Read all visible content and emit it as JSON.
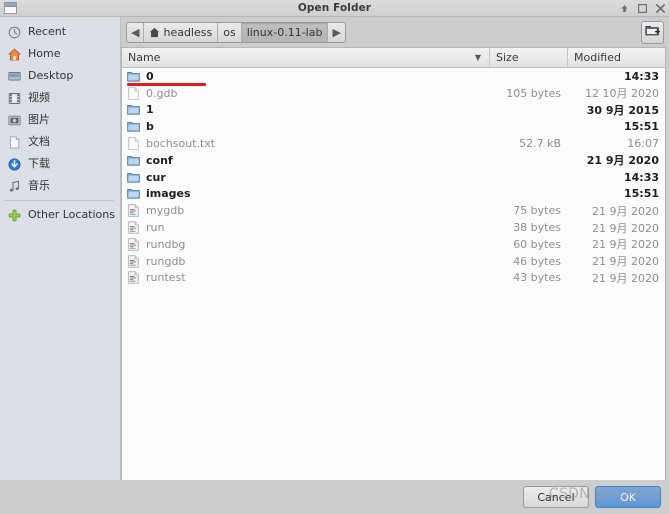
{
  "window": {
    "title": "Open Folder",
    "icon": "window-icon",
    "buttons": [
      {
        "name": "shade-button",
        "glyph": "shade-arrow-icon"
      },
      {
        "name": "maximize-button",
        "glyph": "maximize-icon"
      },
      {
        "name": "close-button",
        "glyph": "close-icon"
      }
    ]
  },
  "sidebar": {
    "items": [
      {
        "label": "Recent",
        "icon": "recent-clock-icon"
      },
      {
        "label": "Home",
        "icon": "home-icon"
      },
      {
        "label": "Desktop",
        "icon": "desktop-icon"
      },
      {
        "label": "视频",
        "icon": "videos-icon"
      },
      {
        "label": "图片",
        "icon": "pictures-icon"
      },
      {
        "label": "文档",
        "icon": "documents-icon"
      },
      {
        "label": "下载",
        "icon": "downloads-icon"
      },
      {
        "label": "音乐",
        "icon": "music-icon"
      }
    ],
    "other_locations": {
      "label": "Other Locations",
      "icon": "plus-icon"
    }
  },
  "pathbar": {
    "prev_arrow": "◀",
    "next_arrow": "▶",
    "crumbs": [
      {
        "label": "headless",
        "icon": "home-icon",
        "selected": false
      },
      {
        "label": "os",
        "icon": "",
        "selected": false
      },
      {
        "label": "linux-0.11-lab",
        "icon": "",
        "selected": true
      }
    ],
    "new_folder_button": "create-folder-icon"
  },
  "filelist": {
    "columns": {
      "name": "Name",
      "size": "Size",
      "modified": "Modified"
    },
    "sort_caret": "▼",
    "rows": [
      {
        "name": "0",
        "type": "dir",
        "size": "",
        "modified": "14:33",
        "annotated": true
      },
      {
        "name": "0.gdb",
        "type": "file",
        "size": "105 bytes",
        "modified": "12 10月 2020",
        "annotated": false
      },
      {
        "name": "1",
        "type": "dir",
        "size": "",
        "modified": "30 9月 2015",
        "annotated": false
      },
      {
        "name": "b",
        "type": "dir",
        "size": "",
        "modified": "15:51",
        "annotated": false
      },
      {
        "name": "bochsout.txt",
        "type": "file",
        "size": "52.7 kB",
        "modified": "16:07",
        "annotated": false
      },
      {
        "name": "conf",
        "type": "dir",
        "size": "",
        "modified": "21 9月 2020",
        "annotated": false
      },
      {
        "name": "cur",
        "type": "dir",
        "size": "",
        "modified": "14:33",
        "annotated": false
      },
      {
        "name": "images",
        "type": "dir",
        "size": "",
        "modified": "15:51",
        "annotated": false
      },
      {
        "name": "mygdb",
        "type": "script",
        "size": "75 bytes",
        "modified": "21 9月 2020",
        "annotated": false
      },
      {
        "name": "run",
        "type": "script",
        "size": "38 bytes",
        "modified": "21 9月 2020",
        "annotated": false
      },
      {
        "name": "rundbg",
        "type": "script",
        "size": "60 bytes",
        "modified": "21 9月 2020",
        "annotated": false
      },
      {
        "name": "rungdb",
        "type": "script",
        "size": "46 bytes",
        "modified": "21 9月 2020",
        "annotated": false
      },
      {
        "name": "runtest",
        "type": "script",
        "size": "43 bytes",
        "modified": "21 9月 2020",
        "annotated": false
      }
    ]
  },
  "actions": {
    "cancel_label": "Cancel",
    "ok_label": "OK"
  },
  "watermark": {
    "text": "CSDN @irontys"
  },
  "colors": {
    "accent": "#5f97d6",
    "annotation_red": "#e01b1b",
    "sidebar_bg": "#dce0e6",
    "window_bg": "#cdcdcd",
    "list_bg": "#fbfbfb"
  }
}
